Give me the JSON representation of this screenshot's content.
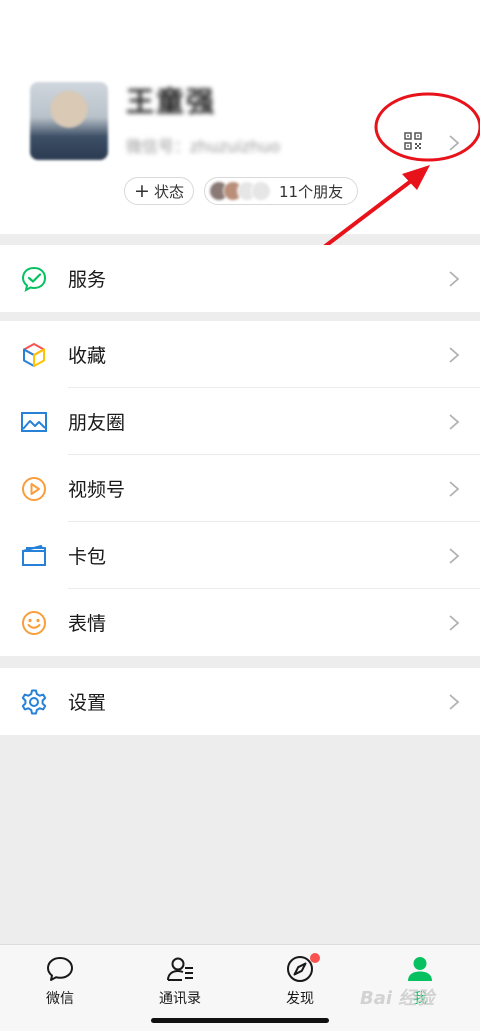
{
  "profile": {
    "nickname": "王童强",
    "wechat_id": "微信号：zhuzuizhuo",
    "status_label": "状态",
    "friends_label": "11个朋友",
    "qr_icon": "qr-code-icon",
    "chevron_icon": "chevron-right-icon"
  },
  "menu": {
    "services": {
      "label": "服务",
      "icon": "services-check-icon",
      "color": "#07c160"
    },
    "favorites": {
      "label": "收藏",
      "icon": "favorites-cube-icon"
    },
    "moments": {
      "label": "朋友圈",
      "icon": "moments-picture-icon",
      "color": "#2782d7"
    },
    "channels": {
      "label": "视频号",
      "icon": "channels-play-icon",
      "color": "#fa9d3b"
    },
    "cards": {
      "label": "卡包",
      "icon": "wallet-card-icon",
      "color": "#2782d7"
    },
    "stickers": {
      "label": "表情",
      "icon": "sticker-smile-icon",
      "color": "#fa9d3b"
    },
    "settings": {
      "label": "设置",
      "icon": "settings-gear-icon",
      "color": "#2782d7"
    }
  },
  "tabbar": {
    "chats": "微信",
    "contacts": "通讯录",
    "discover": "发现",
    "me": "我",
    "active_color": "#07c160",
    "badge_color": "#fa5151"
  },
  "watermark": "Bai 经验"
}
